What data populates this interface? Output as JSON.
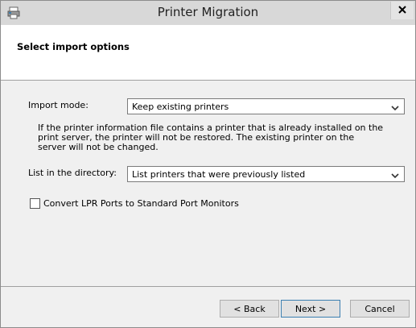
{
  "window": {
    "title": "Printer Migration"
  },
  "header": {
    "title": "Select import options"
  },
  "import_mode": {
    "label": "Import mode:",
    "value": "Keep existing printers"
  },
  "info": {
    "text": "If the printer information file contains a printer that is already installed on the print server, the printer will not be restored. The existing printer on the server will not be changed."
  },
  "directory": {
    "label": "List in the directory:",
    "value": "List printers that were previously listed"
  },
  "convert_lpr": {
    "label": "Convert LPR Ports to Standard Port Monitors",
    "checked": false
  },
  "buttons": {
    "back": "< Back",
    "next": "Next >",
    "cancel": "Cancel"
  },
  "icons": {
    "app": "printer-migration-icon",
    "close": "close-icon",
    "dropdown": "chevron-down-icon"
  }
}
